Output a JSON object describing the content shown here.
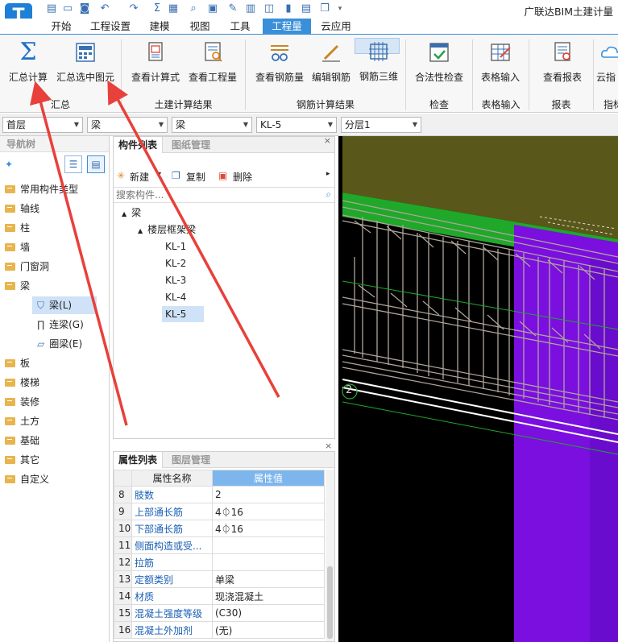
{
  "app": {
    "title": "广联达BIM土建计量",
    "logo": "T"
  },
  "quick_access_icons": [
    "new-file-icon",
    "open-folder-icon",
    "save-icon",
    "undo-icon",
    "redo-icon",
    "sum-icon",
    "table-icon",
    "find-icon",
    "report-icon",
    "edit-icon",
    "grid-icon",
    "layer-icon",
    "column-icon",
    "copy-icon"
  ],
  "menu": {
    "tabs": [
      "开始",
      "工程设置",
      "建模",
      "视图",
      "工具",
      "工程量",
      "云应用"
    ],
    "active": "工程量"
  },
  "ribbon": {
    "buttons": {
      "sum_calc": "汇总计算",
      "sum_selected": "汇总选中图元",
      "view_formula": "查看计算式",
      "view_quantity": "查看工程量",
      "view_rebar_qty": "查看钢筋量",
      "edit_rebar": "编辑钢筋",
      "rebar_3d": "钢筋三维",
      "legality_check": "合法性检查",
      "table_input": "表格输入",
      "view_report": "查看报表",
      "cloud_index": "云指"
    },
    "groups": {
      "summary": "汇总",
      "civil_results": "土建计算结果",
      "rebar_results": "钢筋计算结果",
      "check": "检查",
      "table_input": "表格输入",
      "report": "报表",
      "index": "指标"
    }
  },
  "selectors": {
    "floor": "首层",
    "category": "梁",
    "type": "梁",
    "component": "KL-5",
    "layer": "分层1"
  },
  "nav_tree": {
    "title": "导航树",
    "items": [
      "常用构件类型",
      "轴线",
      "柱",
      "墙",
      "门窗洞",
      "梁",
      "板",
      "楼梯",
      "装修",
      "土方",
      "基础",
      "其它",
      "自定义"
    ],
    "beam_children": [
      "梁(L)",
      "连梁(G)",
      "圈梁(E)"
    ]
  },
  "component_panel": {
    "tabs": [
      "构件列表",
      "图纸管理"
    ],
    "toolbar": {
      "new": "新建",
      "copy": "复制",
      "delete": "删除"
    },
    "search_placeholder": "搜索构件...",
    "root": "梁",
    "group": "楼层框架梁",
    "items": [
      "KL-1",
      "KL-2",
      "KL-3",
      "KL-4",
      "KL-5"
    ],
    "selected": "KL-5"
  },
  "property_panel": {
    "tabs": [
      "属性列表",
      "图层管理"
    ],
    "headers": {
      "name": "属性名称",
      "value": "属性值"
    },
    "rows": [
      {
        "no": "8",
        "name": "肢数",
        "value": "2"
      },
      {
        "no": "9",
        "name": "上部通长筋",
        "value": "4⏀16"
      },
      {
        "no": "10",
        "name": "下部通长筋",
        "value": "4⏀16"
      },
      {
        "no": "11",
        "name": "侧面构造或受...",
        "value": ""
      },
      {
        "no": "12",
        "name": "拉筋",
        "value": ""
      },
      {
        "no": "13",
        "name": "定额类别",
        "value": "单梁"
      },
      {
        "no": "14",
        "name": "材质",
        "value": "现浇混凝土"
      },
      {
        "no": "15",
        "name": "混凝土强度等级",
        "value": "(C30)"
      },
      {
        "no": "16",
        "name": "混凝土外加剂",
        "value": "(无)"
      }
    ]
  },
  "viewport": {
    "axis_label": "2"
  },
  "colors": {
    "accent": "#3a8fd9",
    "arrow": "#e8403a",
    "purple": "#7a0fe0",
    "olive": "#59581a",
    "green": "#1fa82a"
  }
}
